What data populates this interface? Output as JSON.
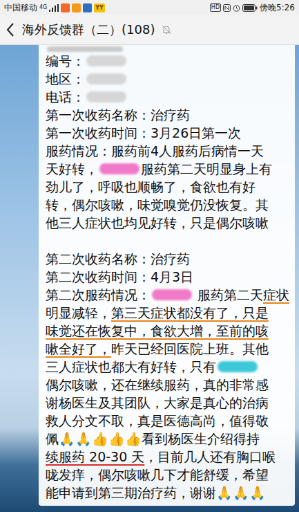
{
  "status_bar": {
    "carrier": "中国移动",
    "network": "4G",
    "app_badge": "YY",
    "hd": "HD",
    "time": "傍晚5:26"
  },
  "title": "海外反馈群（二）(108)",
  "lines": [
    {
      "segments": [
        {
          "kind": "redaction",
          "color": "#c9c9c9"
        }
      ]
    },
    {
      "segments": [
        {
          "kind": "text",
          "text": "编号：",
          "underlined": false
        },
        {
          "kind": "redaction",
          "color": "#d6d6d6"
        }
      ]
    },
    {
      "segments": [
        {
          "kind": "text",
          "text": "地区：",
          "underlined": false
        },
        {
          "kind": "redaction",
          "color": "#d6d6d6"
        }
      ]
    },
    {
      "segments": [
        {
          "kind": "text",
          "text": "电话：",
          "underlined": false
        },
        {
          "kind": "redaction",
          "color": "#d6d6d6"
        }
      ]
    },
    {
      "segments": [
        {
          "kind": "text",
          "text": "第一次收药名称：治疗药",
          "underlined": false
        }
      ]
    },
    {
      "segments": [
        {
          "kind": "text",
          "text": "第一次收药时间：3月26日第一次",
          "underlined": false
        }
      ]
    },
    {
      "segments": [
        {
          "kind": "text",
          "text": "服药情况：服药前4人服药后病情一天",
          "underlined": false
        }
      ]
    },
    {
      "segments": [
        {
          "kind": "text",
          "text": "天好转，",
          "underlined": false
        },
        {
          "kind": "redaction",
          "color": "#f07ac8"
        },
        {
          "kind": "text",
          "text": "服药第二天明显身上有",
          "underlined": false
        }
      ]
    },
    {
      "segments": [
        {
          "kind": "text",
          "text": "劲儿了，呼吸也顺畅了，食欲也有好",
          "underlined": false
        }
      ]
    },
    {
      "segments": [
        {
          "kind": "text",
          "text": "转，偶尔咳嗽，味觉嗅觉仍没恢复。其",
          "underlined": false
        }
      ]
    },
    {
      "segments": [
        {
          "kind": "text",
          "text": "他三人症状也均见好转，只是偶尔咳嗽",
          "underlined": false
        }
      ]
    },
    {
      "segments": []
    },
    {
      "segments": [
        {
          "kind": "text",
          "text": "第二次收药名称：治疗药",
          "underlined": false
        }
      ]
    },
    {
      "segments": [
        {
          "kind": "text",
          "text": "第二次收药时间：4月3日",
          "underlined": false
        }
      ]
    },
    {
      "segments": [
        {
          "kind": "text",
          "text": "第二次服药情况：",
          "underlined": false
        },
        {
          "kind": "redaction",
          "color": "#f07ac8"
        },
        {
          "kind": "text",
          "text": " 服药第二天",
          "underlined": false
        },
        {
          "kind": "text",
          "text": "症状",
          "underlined": true,
          "color": "#e8841f"
        }
      ]
    },
    {
      "segments": [
        {
          "kind": "text",
          "text": "明显减轻，",
          "underlined": false
        },
        {
          "kind": "text",
          "text": "第三天症状都没有了，只是",
          "underlined": true,
          "color": "#e8841f"
        }
      ]
    },
    {
      "segments": [
        {
          "kind": "text",
          "text": "味觉还在恢复中，食欲大增，至前的咳",
          "underlined": true,
          "color": "#e8841f"
        }
      ]
    },
    {
      "segments": [
        {
          "kind": "text",
          "text": "嗽全好了，",
          "underlined": true,
          "color": "#e8841f"
        },
        {
          "kind": "text",
          "text": "昨天已经回医院上班。其他",
          "underlined": false
        }
      ]
    },
    {
      "segments": [
        {
          "kind": "text",
          "text": "三人症状也都大有好转，只有",
          "underlined": false
        },
        {
          "kind": "redaction",
          "color": "#3cc8d8"
        }
      ]
    },
    {
      "segments": [
        {
          "kind": "text",
          "text": "偶尔咳嗽，还在继续服药，真的非常感",
          "underlined": false
        }
      ]
    },
    {
      "segments": [
        {
          "kind": "text",
          "text": "谢杨医生及其团队，大家是真心的治病",
          "underlined": false
        }
      ]
    },
    {
      "segments": [
        {
          "kind": "text",
          "text": "救人分文不取，真是医德高尚，值得敬",
          "underlined": false
        }
      ]
    },
    {
      "segments": [
        {
          "kind": "text",
          "text": "佩🙏🙏👍👍👍看到杨医生介绍得持",
          "underlined": false
        }
      ]
    },
    {
      "segments": [
        {
          "kind": "text",
          "text": "续服药 20-30 天",
          "underlined": true,
          "color": "#d0302a"
        },
        {
          "kind": "text",
          "text": "，目前几人还有胸口喉",
          "underlined": false
        }
      ]
    },
    {
      "segments": [
        {
          "kind": "text",
          "text": "咙发痒，偶尔咳嗽几下才能舒缓，希望",
          "underlined": false
        }
      ]
    },
    {
      "segments": [
        {
          "kind": "text",
          "text": "能申请到第三期治疗药，谢谢🙏🙏🙏",
          "underlined": false
        }
      ]
    }
  ]
}
